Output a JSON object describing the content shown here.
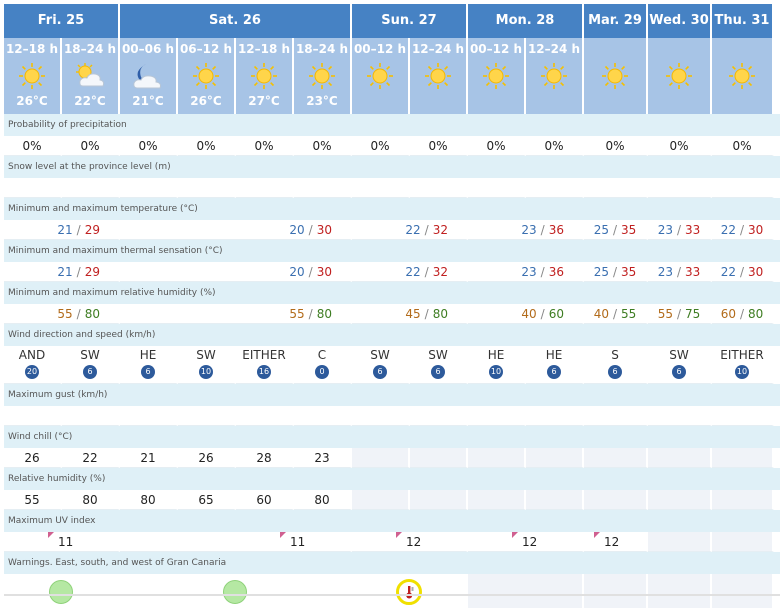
{
  "days": [
    "Fri. 25",
    "Sat. 26",
    "Sun. 27",
    "Mon. 28",
    "Mar. 29",
    "Wed. 30",
    "Thu. 31"
  ],
  "periods": [
    {
      "label": "12–18 h",
      "icon": "sun-icon",
      "temp": "26°C"
    },
    {
      "label": "18–24 h",
      "icon": "sun-cloud-icon",
      "temp": "22°C"
    },
    {
      "label": "00–06 h",
      "icon": "moon-cloud-icon",
      "temp": "21°C"
    },
    {
      "label": "06–12 h",
      "icon": "sun-icon",
      "temp": "26°C"
    },
    {
      "label": "12–18 h",
      "icon": "sun-icon",
      "temp": "27°C"
    },
    {
      "label": "18–24 h",
      "icon": "sun-icon",
      "temp": "23°C"
    },
    {
      "label": "00–12 h",
      "icon": "sun-icon",
      "temp": ""
    },
    {
      "label": "12–24 h",
      "icon": "sun-icon",
      "temp": ""
    },
    {
      "label": "00–12 h",
      "icon": "sun-icon",
      "temp": ""
    },
    {
      "label": "12–24 h",
      "icon": "sun-icon",
      "temp": ""
    },
    {
      "label": "",
      "icon": "sun-icon",
      "temp": ""
    },
    {
      "label": "",
      "icon": "sun-icon",
      "temp": ""
    },
    {
      "label": "",
      "icon": "sun-icon",
      "temp": ""
    }
  ],
  "labels": {
    "precip": "Probability of precipitation",
    "snow": "Snow level at the province level (m)",
    "temp": "Minimum and maximum temperature (°C)",
    "thermal": "Minimum and maximum thermal sensation (°C)",
    "humidity_mm": "Minimum and maximum relative humidity (%)",
    "wind": "Wind direction and speed (km/h)",
    "gust": "Maximum gust (km/h)",
    "chill": "Wind chill (°C)",
    "rh": "Relative humidity (%)",
    "uv": "Maximum UV index",
    "warnings": "Warnings. East, south, and west of Gran Canaria"
  },
  "precip": [
    "0%",
    "0%",
    "0%",
    "0%",
    "0%",
    "0%",
    "0%",
    "0%",
    "0%",
    "0%",
    "0%",
    "0%",
    "0%"
  ],
  "temp": [
    {
      "min": "21",
      "max": "29"
    },
    {
      "min": "20",
      "max": "30"
    },
    {
      "min": "22",
      "max": "32"
    },
    {
      "min": "23",
      "max": "36"
    },
    {
      "min": "25",
      "max": "35"
    },
    {
      "min": "23",
      "max": "33"
    },
    {
      "min": "22",
      "max": "30"
    }
  ],
  "thermal": [
    {
      "min": "21",
      "max": "29"
    },
    {
      "min": "20",
      "max": "30"
    },
    {
      "min": "22",
      "max": "32"
    },
    {
      "min": "23",
      "max": "36"
    },
    {
      "min": "25",
      "max": "35"
    },
    {
      "min": "23",
      "max": "33"
    },
    {
      "min": "22",
      "max": "30"
    }
  ],
  "humidity_mm": [
    {
      "min": "55",
      "max": "80"
    },
    {
      "min": "55",
      "max": "80"
    },
    {
      "min": "45",
      "max": "80"
    },
    {
      "min": "40",
      "max": "60"
    },
    {
      "min": "40",
      "max": "55"
    },
    {
      "min": "55",
      "max": "75"
    },
    {
      "min": "60",
      "max": "80"
    }
  ],
  "wind": [
    {
      "dir": "AND",
      "speed": "20"
    },
    {
      "dir": "SW",
      "speed": "6"
    },
    {
      "dir": "HE",
      "speed": "6"
    },
    {
      "dir": "SW",
      "speed": "10"
    },
    {
      "dir": "EITHER",
      "speed": "16"
    },
    {
      "dir": "C",
      "speed": "0"
    },
    {
      "dir": "SW",
      "speed": "6"
    },
    {
      "dir": "SW",
      "speed": "6"
    },
    {
      "dir": "HE",
      "speed": "10"
    },
    {
      "dir": "HE",
      "speed": "6"
    },
    {
      "dir": "S",
      "speed": "6"
    },
    {
      "dir": "SW",
      "speed": "6"
    },
    {
      "dir": "EITHER",
      "speed": "10"
    }
  ],
  "chill": [
    "26",
    "22",
    "21",
    "26",
    "28",
    "23"
  ],
  "rh": [
    "55",
    "80",
    "80",
    "65",
    "60",
    "80"
  ],
  "uv": [
    "11",
    "11",
    "12",
    "12",
    "12"
  ],
  "colors": {
    "header": "#4682c4",
    "period": "#a7c4e6",
    "label_bg": "#dff0f7",
    "warn_green": "#b5e8a3",
    "warn_yellow": "#f0e000"
  }
}
